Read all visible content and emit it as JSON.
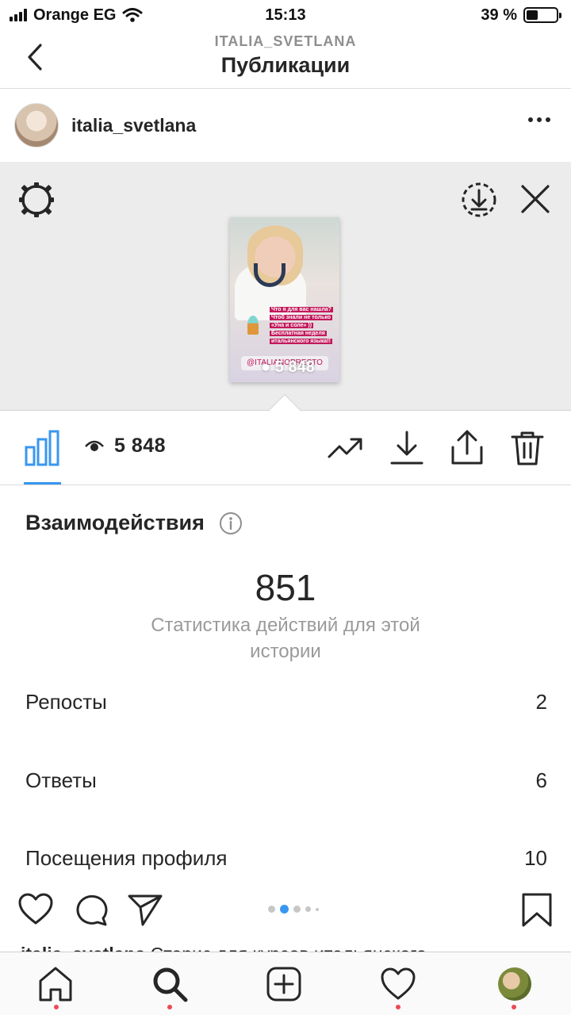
{
  "status_bar": {
    "carrier": "Orange EG",
    "time": "15:13",
    "battery_percent": "39 %",
    "battery_level": 0.39
  },
  "header": {
    "subtitle": "ITALIA_SVETLANA",
    "title": "Публикации"
  },
  "post": {
    "username": "italia_svetlana"
  },
  "story_preview": {
    "caption_lines": [
      "Что я для вас нашла?",
      "Чтоб знали не только",
      "«Уна и соле» ))",
      "Бесплатная неделя",
      "итальянского языка!!"
    ],
    "tag": "@ITALIANOPRESTO",
    "views": "5 848"
  },
  "toolbar": {
    "views": "5 848"
  },
  "interactions": {
    "title": "Взаимодействия",
    "total": "851",
    "caption": "Статистика действий для этой истории",
    "rows": [
      {
        "label": "Репосты",
        "value": "2"
      },
      {
        "label": "Ответы",
        "value": "6"
      },
      {
        "label": "Посещения профиля",
        "value": "10"
      }
    ]
  },
  "caption_peek": {
    "username": "italia_svetlana",
    "text": "Сторис для курсов итальянского"
  },
  "carousel": {
    "count": 5,
    "active_index": 1
  },
  "colors": {
    "accent": "#3897f0",
    "notification_dot": "#ed4956",
    "story_bg": "#ececec"
  },
  "icons": {
    "back": "chevron-left-icon",
    "more": "more-horizontal-icon",
    "settings": "gear-icon",
    "download_circle": "download-circle-icon",
    "close": "close-icon",
    "stats": "bar-chart-icon",
    "eye": "eye-icon",
    "trend": "trending-up-icon",
    "download": "download-icon",
    "share": "share-icon",
    "delete": "trash-icon",
    "info": "info-icon",
    "like": "heart-icon",
    "comment": "comment-icon",
    "send": "send-icon",
    "save": "bookmark-icon",
    "home": "home-icon",
    "search": "search-icon",
    "add": "add-post-icon",
    "activity": "heart-icon",
    "profile": "profile-avatar"
  }
}
